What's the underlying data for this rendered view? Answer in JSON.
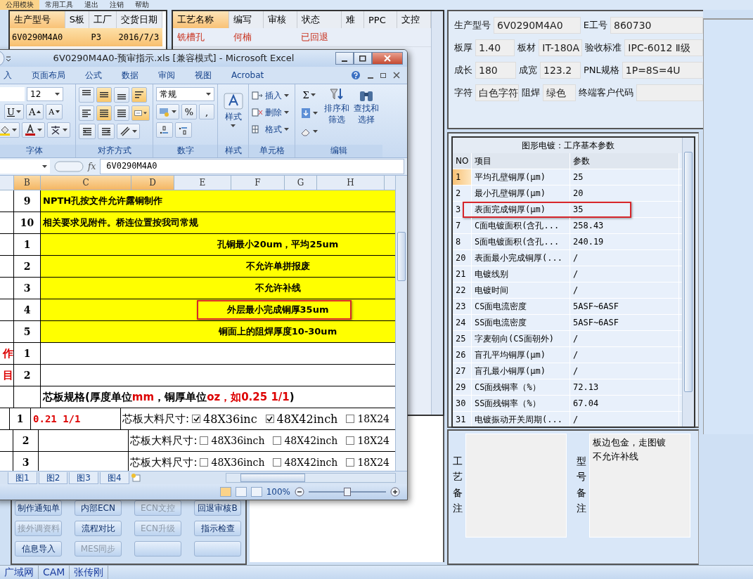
{
  "menu": [
    {
      "label": "公用模块",
      "selected": true
    },
    {
      "label": "常用工具",
      "selected": false
    },
    {
      "label": "退出",
      "selected": false
    },
    {
      "label": "注销",
      "selected": false
    },
    {
      "label": "帮助",
      "selected": false
    }
  ],
  "model_list": {
    "columns": [
      "生产型号",
      "S板",
      "工厂",
      "交货日期"
    ],
    "rows": [
      {
        "model": "6V0290M4A0",
        "factory": "P3",
        "date": "2016/7/3",
        "selected": true
      }
    ]
  },
  "process_table": {
    "columns": [
      "工艺名称",
      "编写",
      "审核",
      "状态",
      "难",
      "PPC",
      "文控"
    ],
    "rows": [
      {
        "name": "铣槽孔",
        "author": "何楠",
        "status": "已回退",
        "rejected": true
      }
    ]
  },
  "action_buttons": [
    {
      "kind": "action",
      "label": "制作通知单",
      "disabled": false
    },
    {
      "kind": "action",
      "label": "内部ECN",
      "disabled": false
    },
    {
      "kind": "action",
      "label": "ECN文控",
      "disabled": true
    },
    {
      "kind": "action",
      "label": "回退审核B",
      "disabled": false
    },
    {
      "kind": "action",
      "label": "接外调资料",
      "disabled": true
    },
    {
      "kind": "action",
      "label": "流程对比",
      "disabled": false
    },
    {
      "kind": "action",
      "label": "ECN升级",
      "disabled": true
    },
    {
      "kind": "action",
      "label": "指示检查",
      "disabled": false
    },
    {
      "kind": "action",
      "label": "信息导入",
      "disabled": false
    },
    {
      "kind": "action",
      "label": "MES同步",
      "disabled": true
    },
    {
      "kind": "blank"
    },
    {
      "kind": "blank"
    }
  ],
  "status_bar": [
    "广域网",
    "CAM",
    "张传刚"
  ],
  "info": [
    [
      {
        "label": "生产型号",
        "value": "6V0290M4A0"
      },
      {
        "label": "E工号",
        "value": "860730"
      }
    ],
    [
      {
        "label": "板厚",
        "value": "1.40"
      },
      {
        "label": "板材",
        "value": "IT-180A"
      },
      {
        "label": "验收标准",
        "value": "IPC-6012 Ⅱ级"
      }
    ],
    [
      {
        "label": "成长",
        "value": "180"
      },
      {
        "label": "成宽",
        "value": "123.2"
      },
      {
        "label": "PNL规格",
        "value": "1P=8S=4U"
      }
    ],
    [
      {
        "label": "字符",
        "value": "白色字符"
      },
      {
        "label": "阻焊",
        "value": "绿色"
      },
      {
        "label": "终端客户代码"
      }
    ]
  ],
  "params": {
    "title": "图形电镀：工序基本参数",
    "columns": [
      "NO",
      "项目",
      "参数"
    ],
    "rows": [
      {
        "no": "1",
        "item": "平均孔壁铜厚(μm)",
        "value": "25",
        "selected": true,
        "annotated": false
      },
      {
        "no": "2",
        "item": "最小孔壁铜厚(μm)",
        "value": "20",
        "selected": false,
        "annotated": false
      },
      {
        "no": "3",
        "item": "表面完成铜厚(μm)",
        "value": "35",
        "selected": false,
        "annotated": true
      },
      {
        "no": "7",
        "item": "C面电镀面积(含孔...",
        "value": "258.43",
        "selected": false,
        "annotated": false
      },
      {
        "no": "8",
        "item": "S面电镀面积(含孔...",
        "value": "240.19",
        "selected": false,
        "annotated": false
      },
      {
        "no": "20",
        "item": "表面最小完成铜厚(...",
        "value": "/",
        "selected": false,
        "annotated": false
      },
      {
        "no": "21",
        "item": "电镀线别",
        "value": "/",
        "selected": false,
        "annotated": false
      },
      {
        "no": "22",
        "item": "电镀时间",
        "value": "/",
        "selected": false,
        "annotated": false
      },
      {
        "no": "23",
        "item": "CS面电流密度",
        "value": "5ASF~6ASF",
        "selected": false,
        "annotated": false
      },
      {
        "no": "24",
        "item": "SS面电流密度",
        "value": "5ASF~6ASF",
        "selected": false,
        "annotated": false
      },
      {
        "no": "25",
        "item": "字麦朝向(CS面朝外)",
        "value": "/",
        "selected": false,
        "annotated": false
      },
      {
        "no": "26",
        "item": "盲孔平均铜厚(μm)",
        "value": "/",
        "selected": false,
        "annotated": false
      },
      {
        "no": "27",
        "item": "盲孔最小铜厚(μm)",
        "value": "/",
        "selected": false,
        "annotated": false
      },
      {
        "no": "29",
        "item": "CS面残铜率（%）",
        "value": "72.13",
        "selected": false,
        "annotated": false
      },
      {
        "no": "30",
        "item": "SS面残铜率（%）",
        "value": "67.04",
        "selected": false,
        "annotated": false
      },
      {
        "no": "31",
        "item": "电镀振动开关周期(...",
        "value": "/",
        "selected": false,
        "annotated": false
      }
    ]
  },
  "remarks": [
    {
      "label": "工艺备注"
    },
    {
      "label": "型号备注",
      "lines": [
        "板边包金，走图镀",
        "不允许补线"
      ]
    }
  ],
  "excel": {
    "title": "6V0290M4A0-预审指示.xls  [兼容模式] - Microsoft Excel",
    "tabs": [
      "入",
      "页面布局",
      "公式",
      "数据",
      "审阅",
      "视图",
      "Acrobat"
    ],
    "ribbon": {
      "font_size": "12",
      "font_glyphs": [
        "U",
        "A",
        "A"
      ],
      "number_format": "常规",
      "number_glyphs": [
        "%",
        ","
      ],
      "sigma": "Σ",
      "groups": [
        "字体",
        "对齐方式",
        "数字",
        "样式",
        "单元格",
        "编辑"
      ],
      "style_label": "样式",
      "cell_actions": [
        "插入",
        "删除",
        "格式"
      ],
      "edit_actions": [
        [
          "排序和",
          "筛选"
        ],
        [
          "查找和",
          "选择"
        ]
      ]
    },
    "fx": "fx",
    "formula": "6V0290M4A0",
    "columns": [
      {
        "label": "B",
        "selected": true
      },
      {
        "label": "C",
        "selected": true
      },
      {
        "label": "D",
        "selected": true
      },
      {
        "label": "E",
        "selected": false
      },
      {
        "label": "F",
        "selected": false
      },
      {
        "label": "G",
        "selected": false
      },
      {
        "label": "H",
        "selected": false
      }
    ],
    "rows": [
      {
        "kind": "note",
        "num": "9",
        "text": "NPTH孔按文件允许露铜制作",
        "highlighted": false
      },
      {
        "kind": "note",
        "num": "10",
        "text": "相关要求见附件。桥连位置按我司常规",
        "highlighted": false
      },
      {
        "kind": "requirement",
        "num": "1",
        "text": "孔铜最小20um，平均25um",
        "highlighted": false
      },
      {
        "kind": "requirement",
        "num": "2",
        "text": "不允许单拼报废",
        "highlighted": false
      },
      {
        "kind": "requirement",
        "num": "3",
        "text": "不允许补线",
        "highlighted": false
      },
      {
        "kind": "requirement",
        "num": "4",
        "text": "外层最小完成铜厚35um",
        "highlighted": true
      },
      {
        "kind": "requirement",
        "num": "5",
        "text": "铜面上的阻焊厚度10-30um",
        "highlighted": false
      },
      {
        "kind": "blank",
        "num": "1",
        "side_label": "作"
      },
      {
        "kind": "blank",
        "num": "2",
        "side_label": "目"
      },
      {
        "kind": "heading",
        "segments": [
          {
            "text": "芯板规格(厚度单位",
            "red": false
          },
          {
            "text": "mm",
            "red": true
          },
          {
            "text": "，铜厚单位",
            "red": false
          },
          {
            "text": "oz，如0.25 1/1",
            "red": true
          },
          {
            "text": ")",
            "red": false
          }
        ]
      },
      {
        "kind": "core",
        "num": "1",
        "value": "0.21 1/1",
        "label": "芯板大料尺寸:",
        "options": [
          {
            "label": "48X36inc",
            "checked": true
          },
          {
            "label": "48X42inch",
            "checked": true
          },
          {
            "label": "18X24",
            "checked": false
          }
        ]
      },
      {
        "kind": "core",
        "num": "2",
        "label": "芯板大料尺寸:",
        "options": [
          {
            "label": "48X36inch",
            "checked": false
          },
          {
            "label": "48X42inch",
            "checked": false
          },
          {
            "label": "18X24",
            "checked": false
          }
        ]
      },
      {
        "kind": "core",
        "num": "3",
        "label": "芯板大料尺寸:",
        "options": [
          {
            "label": "48X36inch",
            "checked": false
          },
          {
            "label": "48X42inch",
            "checked": false
          },
          {
            "label": "18X24",
            "checked": false
          }
        ]
      }
    ],
    "sheet_tabs": [
      "图1",
      "图2",
      "图3",
      "图4"
    ],
    "zoom": "100%",
    "zoom_slider": {
      "level": 0.5
    }
  }
}
